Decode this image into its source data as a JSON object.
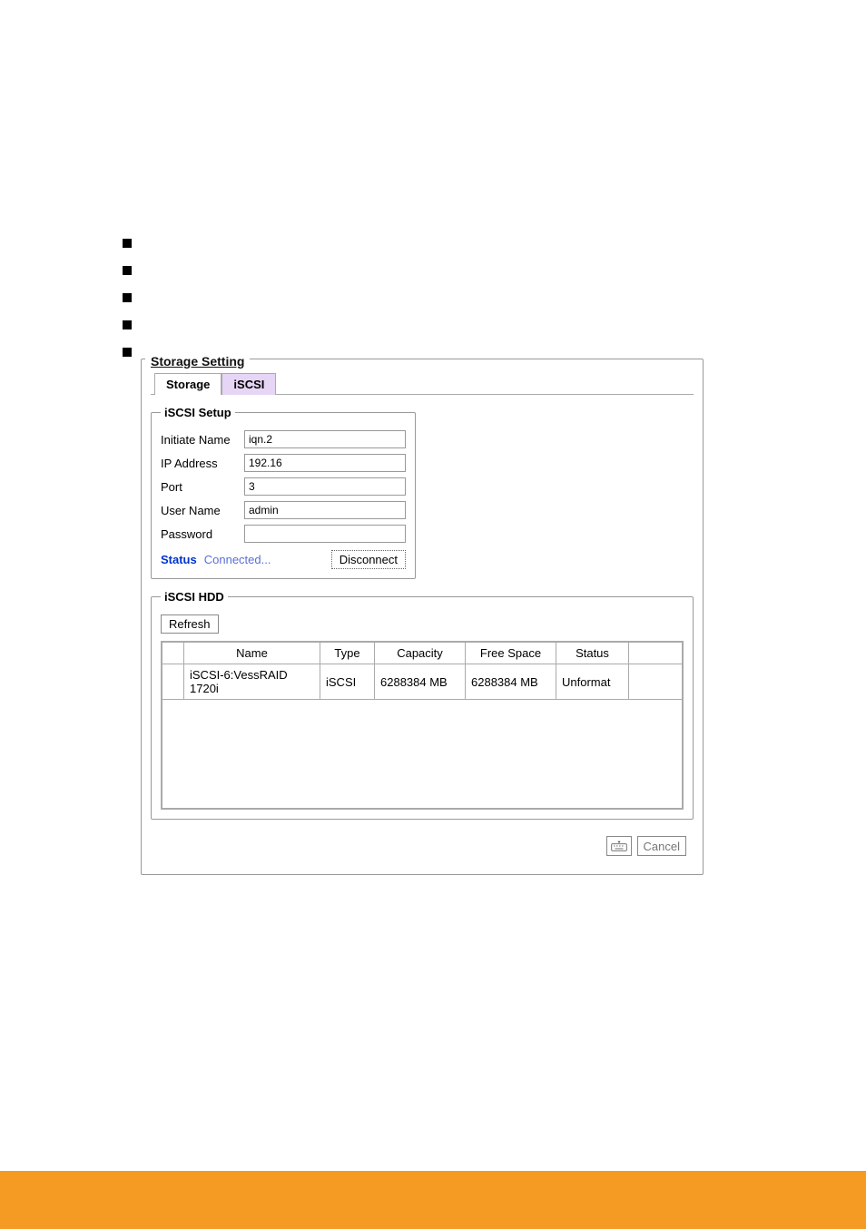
{
  "panel_title": "Storage Setting",
  "tabs": {
    "storage": "Storage",
    "iscsi": "iSCSI"
  },
  "iscsi_setup": {
    "legend": "iSCSI Setup",
    "initiate_name_label": "Initiate Name",
    "initiate_name_value": "iqn.2",
    "ip_address_label": "IP Address",
    "ip_address_value": "192.16",
    "port_label": "Port",
    "port_value": "3",
    "user_name_label": "User Name",
    "user_name_value": "admin",
    "password_label": "Password",
    "password_value": "",
    "status_label": "Status",
    "status_value": "Connected...",
    "disconnect_btn": "Disconnect"
  },
  "iscsi_hdd": {
    "legend": "iSCSI HDD",
    "refresh_btn": "Refresh",
    "columns": {
      "name": "Name",
      "type": "Type",
      "capacity": "Capacity",
      "free_space": "Free Space",
      "status": "Status"
    },
    "rows": [
      {
        "name": "iSCSI-6:VessRAID 1720i",
        "type": "iSCSI",
        "capacity": "6288384 MB",
        "free_space": "6288384 MB",
        "status": "Unformat"
      }
    ]
  },
  "footer": {
    "cancel": "Cancel"
  }
}
